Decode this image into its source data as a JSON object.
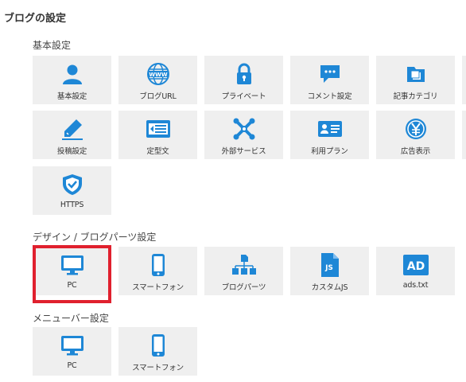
{
  "page": {
    "title": "ブログの設定"
  },
  "colors": {
    "icon": "#1e87d6",
    "tile_bg": "#efefef",
    "highlight": "#e0202e"
  },
  "sections": {
    "basic": {
      "title": "基本設定",
      "items": [
        {
          "label": "基本設定",
          "icon": "user-icon"
        },
        {
          "label": "ブログURL",
          "icon": "www-globe-icon"
        },
        {
          "label": "プライベート",
          "icon": "lock-icon"
        },
        {
          "label": "コメント設定",
          "icon": "comment-icon"
        },
        {
          "label": "記事カテゴリ",
          "icon": "folder-icon"
        },
        {
          "label": "投稿設定",
          "icon": "pencil-icon"
        },
        {
          "label": "定型文",
          "icon": "list-template-icon"
        },
        {
          "label": "外部サービス",
          "icon": "external-service-icon"
        },
        {
          "label": "利用プラン",
          "icon": "id-card-icon"
        },
        {
          "label": "広告表示",
          "icon": "yen-coin-icon"
        },
        {
          "label": "HTTPS",
          "icon": "shield-check-icon"
        }
      ]
    },
    "design": {
      "title": "デザイン / ブログパーツ設定",
      "items": [
        {
          "label": "PC",
          "icon": "monitor-icon"
        },
        {
          "label": "スマートフォン",
          "icon": "smartphone-icon"
        },
        {
          "label": "ブログパーツ",
          "icon": "blog-parts-icon"
        },
        {
          "label": "カスタムJS",
          "icon": "js-file-icon",
          "icon_text": "JS"
        },
        {
          "label": "ads.txt",
          "icon": "ad-badge-icon",
          "icon_text": "AD"
        }
      ]
    },
    "menubar": {
      "title": "メニューバー設定",
      "items": [
        {
          "label": "PC",
          "icon": "monitor-icon"
        },
        {
          "label": "スマートフォン",
          "icon": "smartphone-icon"
        }
      ]
    }
  }
}
